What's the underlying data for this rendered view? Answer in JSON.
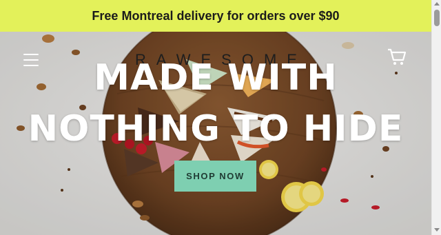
{
  "announcement": {
    "text": "Free Montreal delivery for orders over $90",
    "background": "#e3f15a"
  },
  "header": {
    "logo": "RAWESOME",
    "menu_icon": "hamburger-menu-icon",
    "cart_icon": "shopping-cart-icon"
  },
  "hero": {
    "headline_line1": "MADE WITH",
    "headline_line2": "NOTHING TO HIDE",
    "cta_label": "SHOP NOW",
    "cta_color": "#7ecfb1"
  }
}
